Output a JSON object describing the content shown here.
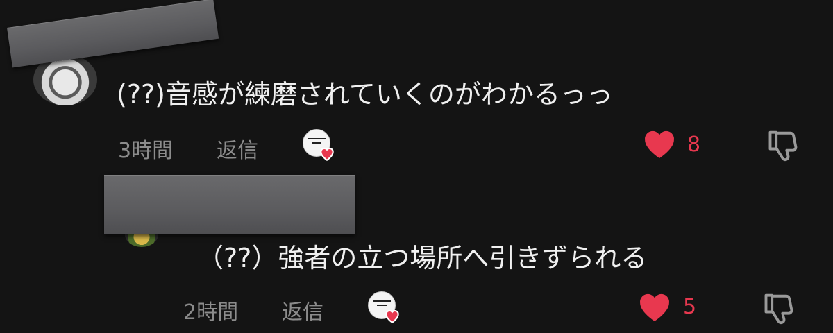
{
  "comments": [
    {
      "text": "(??)音感が練磨されていくのがわかるっっ",
      "time": "3時間",
      "reply_label": "返信",
      "like_count": "8"
    },
    {
      "text": "（??）強者の立つ場所へ引きずられる",
      "time": "2時間",
      "reply_label": "返信",
      "like_count": "5"
    }
  ],
  "icons": {
    "like": "heart-icon",
    "dislike": "thumbs-down-icon",
    "creator_liked": "creator-liked-badge"
  },
  "colors": {
    "background": "#141414",
    "like_red": "#e8384f",
    "meta_gray": "#8c8c8c",
    "text": "#f0f0f0"
  }
}
